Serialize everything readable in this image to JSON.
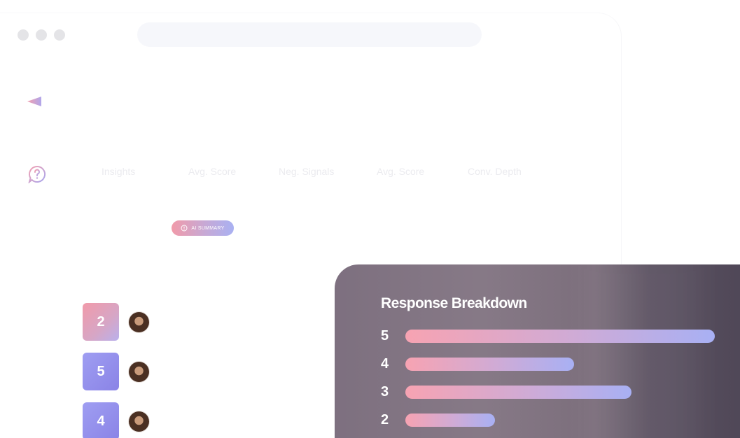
{
  "window": {
    "controls": [
      "close",
      "minimize",
      "maximize"
    ],
    "url": ""
  },
  "sidebar": {
    "icons": [
      "send-icon",
      "help-chat-icon"
    ]
  },
  "stats": {
    "labels": [
      "Insights",
      "Avg. Score",
      "Neg. Signals",
      "Avg. Score",
      "Conv. Depth"
    ]
  },
  "ai_summary": {
    "label": "AI SUMMARY",
    "icon": "info-icon"
  },
  "ratings": [
    {
      "score": "2",
      "style": "pink",
      "avatar": "avatar-icon"
    },
    {
      "score": "5",
      "style": "violet",
      "avatar": "avatar-icon"
    },
    {
      "score": "4",
      "style": "violet",
      "avatar": "avatar-icon"
    }
  ],
  "breakdown": {
    "title": "Response Breakdown",
    "rows": [
      {
        "label": "5",
        "fraction": 1.0
      },
      {
        "label": "4",
        "fraction": 0.545
      },
      {
        "label": "3",
        "fraction": 0.73
      },
      {
        "label": "2",
        "fraction": 0.29
      }
    ]
  },
  "colors": {
    "accent_pink": "#f19aa9",
    "accent_violet": "#a9b1f2",
    "panel_dark": "#4e4656"
  }
}
